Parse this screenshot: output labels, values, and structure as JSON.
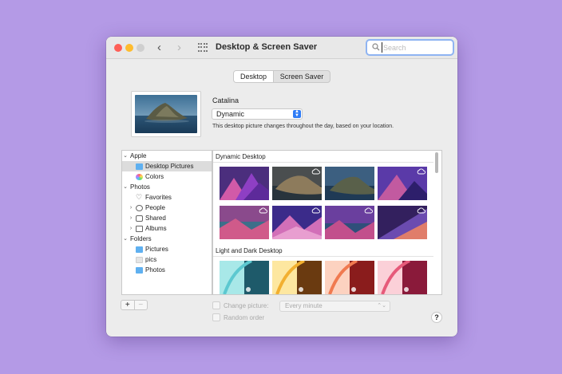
{
  "window": {
    "title": "Desktop & Screen Saver"
  },
  "search": {
    "placeholder": "Search",
    "value": ""
  },
  "tabs": [
    {
      "label": "Desktop",
      "active": true
    },
    {
      "label": "Screen Saver",
      "active": false
    }
  ],
  "picture": {
    "name": "Catalina",
    "mode_selected": "Dynamic",
    "description": "This desktop picture changes throughout the day, based on your location."
  },
  "sidebar": {
    "groups": [
      {
        "label": "Apple",
        "items": [
          "Desktop Pictures",
          "Colors"
        ]
      },
      {
        "label": "Photos",
        "items": [
          "Favorites",
          "People",
          "Shared",
          "Albums"
        ]
      },
      {
        "label": "Folders",
        "items": [
          "Pictures",
          "pics",
          "Photos"
        ]
      }
    ],
    "selected": "Desktop Pictures"
  },
  "gallery": {
    "sections": [
      "Dynamic Desktop",
      "Light and Dark Desktop"
    ]
  },
  "options": {
    "change_picture_label": "Change picture:",
    "interval_value": "Every minute",
    "random_order_label": "Random order"
  },
  "buttons": {
    "add": "+",
    "remove": "−",
    "help": "?"
  },
  "colors": {
    "accent": "#2f7cf6",
    "background": "#b49ae6",
    "search_focus": "#8fb4f2",
    "folder": "#5fb0f0"
  }
}
